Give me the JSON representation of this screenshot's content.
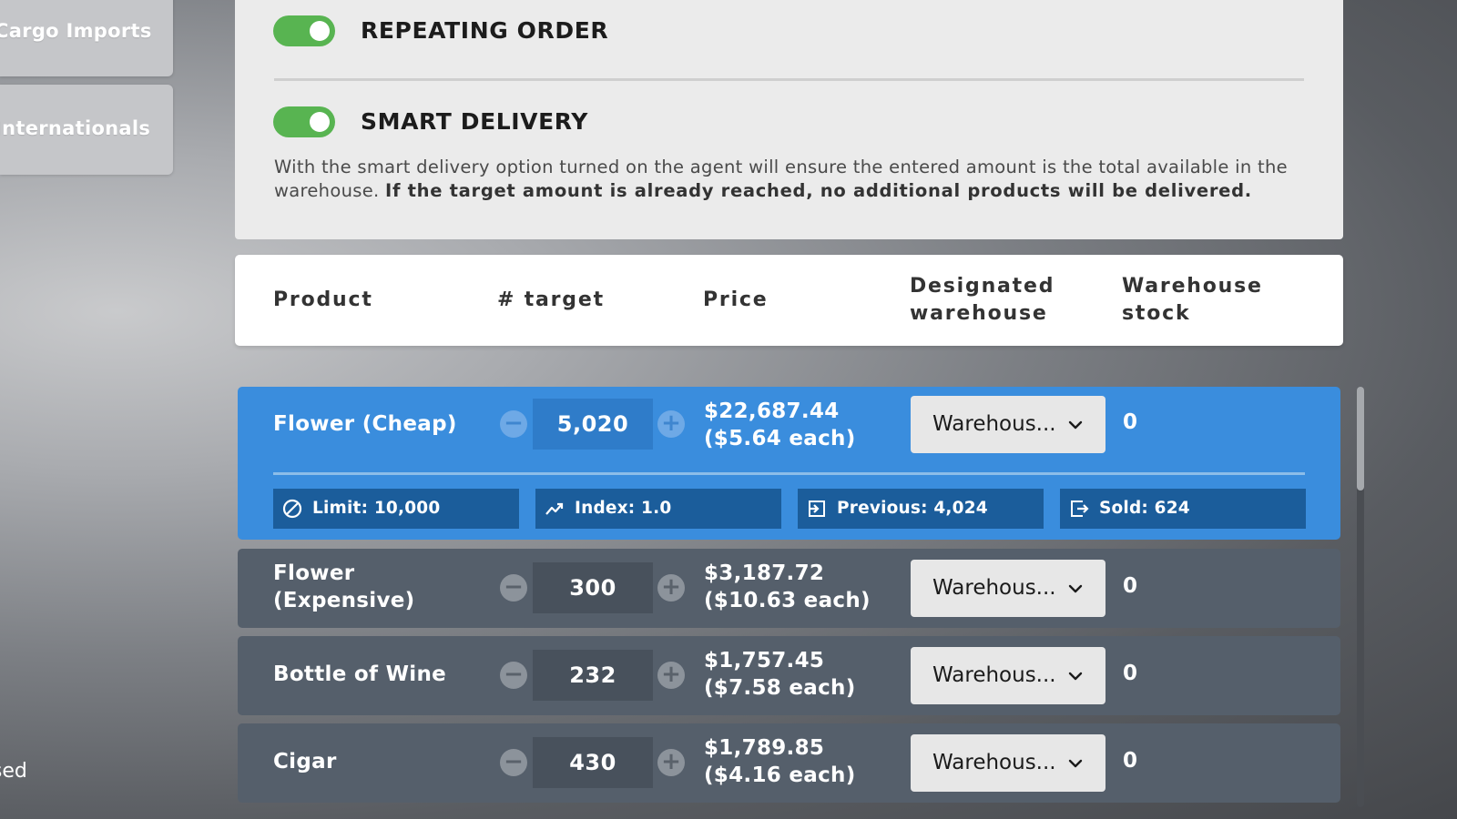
{
  "sidebar": {
    "items": [
      {
        "label": "Cargo Imports"
      },
      {
        "label": "Internationals"
      }
    ],
    "bottom_label": "Closed"
  },
  "settings": {
    "repeating_order": {
      "label": "REPEATING ORDER",
      "enabled": true
    },
    "smart_delivery": {
      "label": "SMART DELIVERY",
      "enabled": true,
      "description": "With the smart delivery option turned on the agent will ensure the entered amount is the total available in the warehouse.",
      "description_bold": "If the target amount is already reached, no additional products will be delivered."
    }
  },
  "table": {
    "headers": {
      "product": "Product",
      "target": "# target",
      "price": "Price",
      "warehouse_line1": "Designated",
      "warehouse_line2": "warehouse",
      "stock_line1": "Warehouse",
      "stock_line2": "stock"
    },
    "rows": [
      {
        "product": "Flower (Cheap)",
        "target": "5,020",
        "price": "$22,687.44 ($5.64 each)",
        "warehouse": "Warehous...",
        "stock": "0",
        "selected": true,
        "stats": {
          "limit": "Limit: 10,000",
          "index": "Index: 1.0",
          "previous": "Previous: 4,024",
          "sold": "Sold: 624"
        }
      },
      {
        "product": "Flower (Expensive)",
        "target": "300",
        "price": "$3,187.72 ($10.63 each)",
        "warehouse": "Warehous...",
        "stock": "0",
        "selected": false
      },
      {
        "product": "Bottle of Wine",
        "target": "232",
        "price": "$1,757.45 ($7.58 each)",
        "warehouse": "Warehous...",
        "stock": "0",
        "selected": false
      },
      {
        "product": "Cigar",
        "target": "430",
        "price": "$1,789.85 ($4.16 each)",
        "warehouse": "Warehous...",
        "stock": "0",
        "selected": false
      }
    ]
  },
  "icons": {
    "stepper_minus": "−",
    "stepper_plus": "+",
    "limit": "no-entry-icon",
    "index": "trend-up-icon",
    "previous": "import-icon",
    "sold": "export-icon",
    "dropdown": "chevron-down-icon"
  },
  "colors": {
    "toggle_on": "#58b451",
    "selected_row": "#3a8ddd",
    "row": "#555f6b",
    "stat_chip": "#1b5d9b"
  }
}
